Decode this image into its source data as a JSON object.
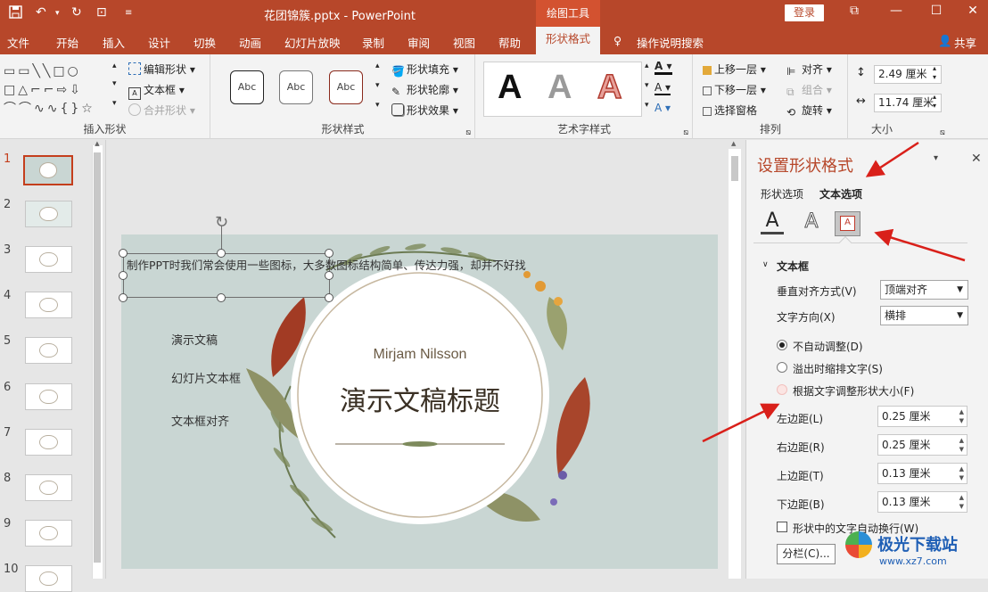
{
  "titlebar": {
    "doc_title": "花团锦簇.pptx  -  PowerPoint",
    "context_tool": "绘图工具",
    "login": "登录",
    "win_ctrl": [
      "□",
      "—",
      "☐",
      "✕"
    ]
  },
  "menu": {
    "tabs": [
      "文件",
      "开始",
      "插入",
      "设计",
      "切换",
      "动画",
      "幻灯片放映",
      "录制",
      "审阅",
      "视图",
      "帮助"
    ],
    "active_tab": "形状格式",
    "tell_me": "操作说明搜索",
    "share": "共享"
  },
  "ribbon": {
    "insert_shapes": {
      "edit_shape": "编辑形状",
      "text_box": "文本框",
      "merge_shapes": "合并形状",
      "label": "插入形状"
    },
    "shape_styles": {
      "abc": "Abc",
      "fill": "形状填充",
      "outline": "形状轮廓",
      "effects": "形状效果",
      "label": "形状样式"
    },
    "wordart": {
      "letter": "A",
      "label": "艺术字样式"
    },
    "arrange": {
      "bring_forward": "上移一层",
      "send_backward": "下移一层",
      "selection_pane": "选择窗格",
      "align": "对齐",
      "group": "组合",
      "rotate": "旋转",
      "label": "排列"
    },
    "size": {
      "height": "2.49 厘米",
      "width": "11.74 厘米",
      "label": "大小"
    }
  },
  "thumbnails": {
    "numbers": [
      "1",
      "2",
      "3",
      "4",
      "5",
      "6",
      "7",
      "8",
      "9",
      "10"
    ],
    "selected": "1"
  },
  "slide": {
    "textbox_text": "制作PPT时我们常会使用一些图标，大多数图标结构简单、传达力强，却并不好找",
    "items": [
      "演示文稿",
      "幻灯片文本框",
      "文本框对齐"
    ],
    "name": "Mirjam Nilsson",
    "title": "演示文稿标题"
  },
  "panel": {
    "title": "设置形状格式",
    "tab_shape": "形状选项",
    "tab_text": "文本选项",
    "section": "文本框",
    "valign_label": "垂直对齐方式(V)",
    "valign_value": "顶端对齐",
    "dir_label": "文字方向(X)",
    "dir_value": "横排",
    "radio_no_autofit": "不自动调整(D)",
    "radio_shrink": "溢出时缩排文字(S)",
    "radio_resize": "根据文字调整形状大小(F)",
    "left_label": "左边距(L)",
    "left_value": "0.25 厘米",
    "right_label": "右边距(R)",
    "right_value": "0.25 厘米",
    "top_label": "上边距(T)",
    "top_value": "0.13 厘米",
    "bottom_label": "下边距(B)",
    "bottom_value": "0.13 厘米",
    "wrap_label": "形状中的文字自动换行(W)",
    "columns_button": "分栏(C)..."
  },
  "watermark": {
    "text": "极光下载站",
    "url": "www.xz7.com"
  },
  "colors": {
    "accent": "#b7472a",
    "context": "#d35230",
    "arrow": "#d9201a"
  }
}
